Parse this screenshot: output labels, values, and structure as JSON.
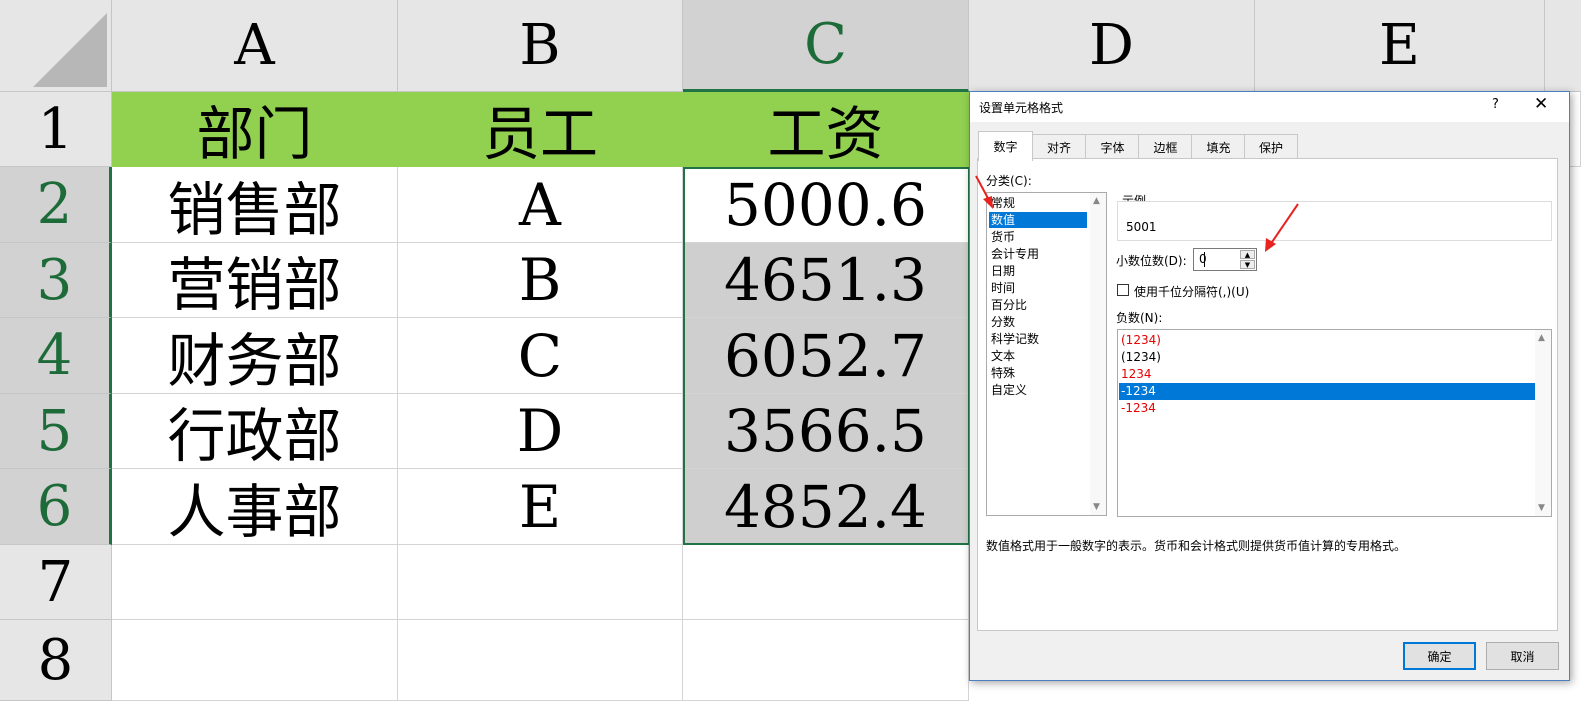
{
  "sheet": {
    "columns": [
      "A",
      "B",
      "C",
      "D",
      "E"
    ],
    "rows": [
      "1",
      "2",
      "3",
      "4",
      "5",
      "6",
      "7",
      "8"
    ],
    "header": [
      "部门",
      "员工",
      "工资"
    ],
    "data": [
      [
        "销售部",
        "A",
        "5000.6"
      ],
      [
        "营销部",
        "B",
        "4651.3"
      ],
      [
        "财务部",
        "C",
        "6052.7"
      ],
      [
        "行政部",
        "D",
        "3566.5"
      ],
      [
        "人事部",
        "E",
        "4852.4"
      ]
    ],
    "selected_column": "C",
    "selected_range": "C2:C6",
    "header_fill": "#92d050",
    "selection_color": "#217346"
  },
  "dialog": {
    "title": "设置单元格格式",
    "help": "?",
    "close": "✕",
    "tabs": [
      "数字",
      "对齐",
      "字体",
      "边框",
      "填充",
      "保护"
    ],
    "active_tab": "数字",
    "category_label": "分类(C):",
    "categories": [
      "常规",
      "数值",
      "货币",
      "会计专用",
      "日期",
      "时间",
      "百分比",
      "分数",
      "科学记数",
      "文本",
      "特殊",
      "自定义"
    ],
    "selected_category": "数值",
    "sample_label": "示例",
    "sample_value": "5001",
    "decimal_label": "小数位数(D):",
    "decimal_value": "0",
    "thousands_label": "使用千位分隔符(,)(U)",
    "thousands_checked": false,
    "negative_label": "负数(N):",
    "negative_options": [
      {
        "text": "(1234)",
        "red": true
      },
      {
        "text": "(1234)",
        "red": false
      },
      {
        "text": "1234",
        "red": true
      },
      {
        "text": "-1234",
        "red": false
      },
      {
        "text": "-1234",
        "red": true
      }
    ],
    "selected_negative_index": 3,
    "description": "数值格式用于一般数字的表示。货币和会计格式则提供货币值计算的专用格式。",
    "ok_label": "确定",
    "cancel_label": "取消"
  },
  "annotation_color": "#e8231f"
}
